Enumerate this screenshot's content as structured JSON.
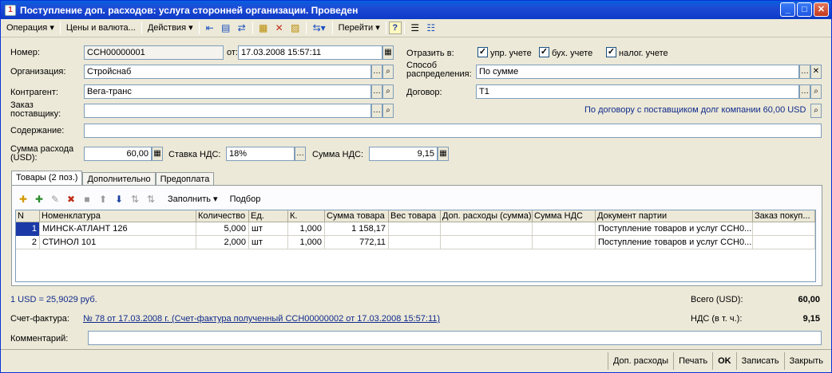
{
  "window": {
    "title": "Поступление доп. расходов: услуга сторонней организации. Проведен",
    "min": "_",
    "max": "□",
    "close": "✕"
  },
  "toolbar": {
    "operation": "Операция ▾",
    "prices": "Цены и валюта...",
    "actions": "Действия ▾",
    "goto": "Перейти ▾",
    "help": "?"
  },
  "form": {
    "number_label": "Номер:",
    "number": "ССН00000001",
    "from_label": "от:",
    "date": "17.03.2008 15:57:11",
    "org_label": "Организация:",
    "org": "Стройснаб",
    "contr_label": "Контрагент:",
    "contr": "Вега-транс",
    "order_label": "Заказ поставщику:",
    "order": "",
    "content_label": "Содержание:",
    "content": "",
    "sum_label": "Сумма расхода (USD):",
    "sum": "60,00",
    "vat_rate_label": "Ставка НДС:",
    "vat_rate": "18%",
    "vat_sum_label": "Сумма НДС:",
    "vat_sum": "9,15",
    "reflect_label": "Отразить в:",
    "chk1": "упр. учете",
    "chk2": "бух. учете",
    "chk3": "налог. учете",
    "dist_label": "Способ распределения:",
    "dist": "По сумме",
    "contract_label": "Договор:",
    "contract": "Т1",
    "debt_text": "По договору с поставщиком долг компании 60,00 USD"
  },
  "tabs": [
    "Товары (2 поз.)",
    "Дополнительно",
    "Предоплата"
  ],
  "table_toolbar": {
    "fill": "Заполнить ▾",
    "select": "Подбор"
  },
  "table": {
    "columns": [
      "N",
      "Номенклатура",
      "Количество",
      "Ед.",
      "К.",
      "Сумма товара",
      "Вес товара",
      "Доп. расходы (сумма)",
      "Сумма НДС",
      "Документ партии",
      "Заказ покуп..."
    ],
    "rows": [
      [
        "1",
        "МИНСК-АТЛАНТ 126",
        "5,000",
        "шт",
        "1,000",
        "1 158,17",
        "",
        "",
        "",
        "Поступление товаров и услуг ССН0...",
        ""
      ],
      [
        "2",
        "СТИНОЛ 101",
        "2,000",
        "шт",
        "1,000",
        "772,11",
        "",
        "",
        "",
        "Поступление товаров и услуг ССН0...",
        ""
      ]
    ]
  },
  "footer": {
    "rate": "1 USD = 25,9029 руб.",
    "total_label": "Всего (USD):",
    "total": "60,00",
    "invoice_label": "Счет-фактура:",
    "invoice": "№ 78 от 17.03.2008 г. (Счет-фактура полученный ССН00000002 от 17.03.2008 15:57:11)",
    "vat_label": "НДС (в т. ч.):",
    "vat": "9,15",
    "comment_label": "Комментарий:",
    "comment": ""
  },
  "buttons": {
    "extra": "Доп. расходы",
    "print": "Печать",
    "ok": "OK",
    "save": "Записать",
    "close": "Закрыть"
  }
}
